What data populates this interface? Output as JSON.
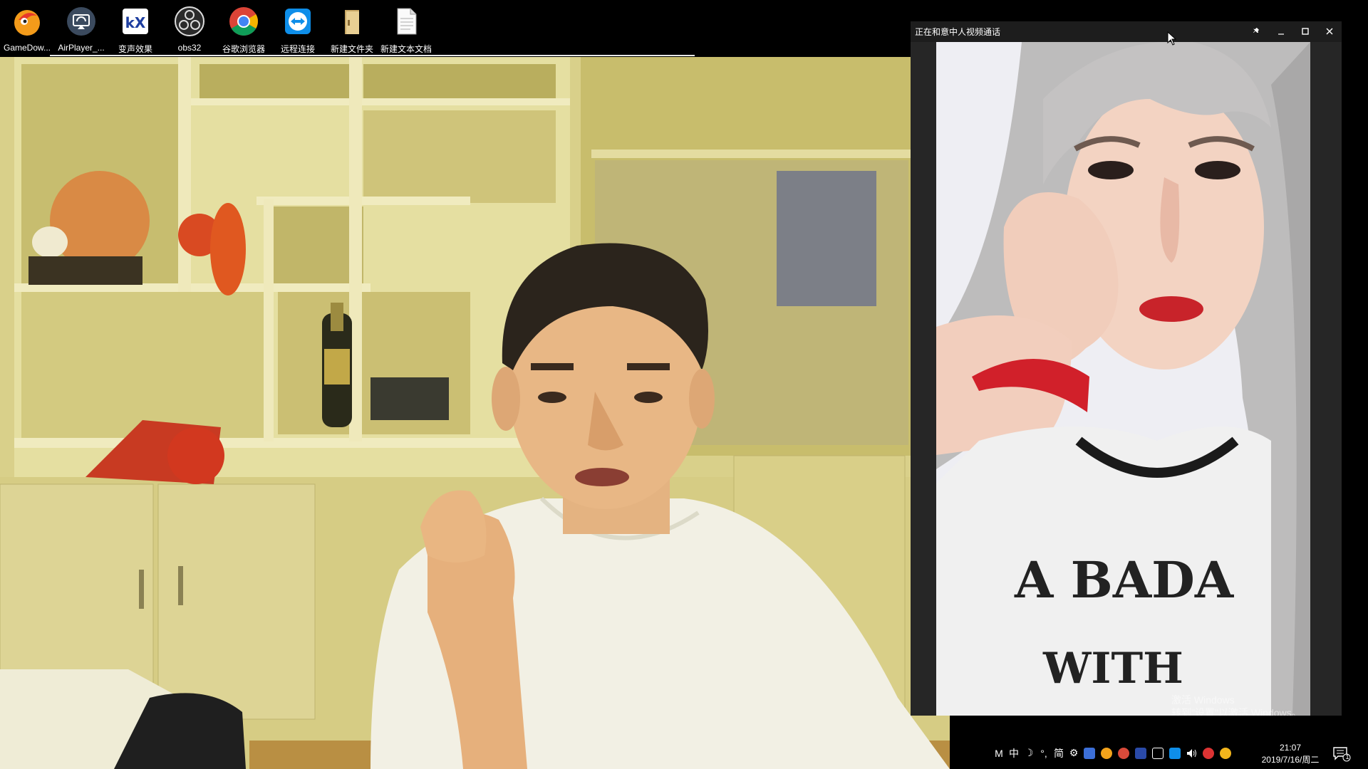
{
  "desktop": {
    "icons": [
      {
        "label": "GameDow...",
        "icon": "gamedownload-icon"
      },
      {
        "label": "AirPlayer_...",
        "icon": "airplayer-icon"
      },
      {
        "label": "变声效果",
        "icon": "voice-changer-icon"
      },
      {
        "label": "obs32",
        "icon": "obs-icon"
      },
      {
        "label": "谷歌浏览器",
        "icon": "chrome-icon"
      },
      {
        "label": "远程连接",
        "icon": "teamviewer-icon"
      },
      {
        "label": "新建文件夹",
        "icon": "folder-icon"
      },
      {
        "label": "新建文本文档",
        "icon": "text-document-icon"
      }
    ]
  },
  "call_window": {
    "title": "正在和意中人视频通话",
    "watermark_line1": "激活 Windows",
    "watermark_line2": "转到\"设置\"以激活 Windows。"
  },
  "tray": {
    "items": [
      "M",
      "中",
      "☽",
      "°,",
      "简",
      "⚙"
    ],
    "time": "21:07",
    "date": "2019/7/16/周二",
    "notification_count": "1"
  },
  "colors": {
    "desktop_bg": "#000000",
    "window_bg": "#1d1d1d",
    "room_wall": "#d7cf86"
  }
}
